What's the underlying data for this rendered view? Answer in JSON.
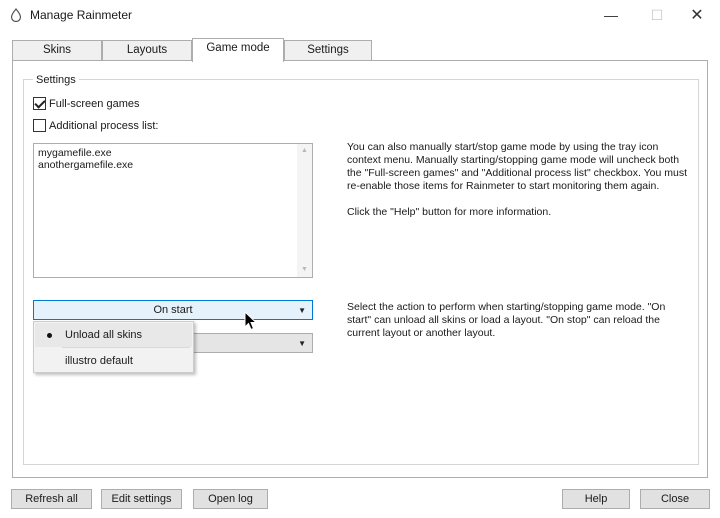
{
  "window": {
    "title": "Manage Rainmeter",
    "app_icon": "rainmeter-drop-icon",
    "controls": {
      "minimize": "—",
      "maximize": "☐",
      "close": "✕"
    }
  },
  "tabs": [
    {
      "label": "Skins",
      "active": false
    },
    {
      "label": "Layouts",
      "active": false
    },
    {
      "label": "Game mode",
      "active": true
    },
    {
      "label": "Settings",
      "active": false
    }
  ],
  "settings": {
    "group_label": "Settings",
    "fullscreen_label": "Full-screen games",
    "fullscreen_checked": true,
    "process_list_label": "Additional process list:",
    "process_list_checked": false,
    "process_items": [
      "mygamefile.exe",
      "anothergamefile.exe"
    ],
    "description_1": "You can also manually start/stop game mode by using the tray icon context menu. Manually starting/stopping game mode will uncheck both the \"Full-screen games\" and \"Additional process list\" checkbox. You must re-enable those items for Rainmeter to start monitoring them again.",
    "description_2": "Click the \"Help\" button for more information.",
    "description_3": "Select the action to perform when starting/stopping game mode. \"On start\" can unload all skins or load a layout. \"On stop\" can reload the current layout or another layout.",
    "on_start_value": "On start",
    "on_stop_value": "",
    "dropdown_options": [
      {
        "label": "Unload all skins",
        "selected": true
      },
      {
        "label": "illustro default",
        "selected": false
      }
    ]
  },
  "buttons": {
    "refresh_all": "Refresh all",
    "edit_settings": "Edit settings",
    "open_log": "Open log",
    "help": "Help",
    "close": "Close"
  },
  "colors": {
    "focus_border": "#0078d7",
    "focus_fill": "#e5f1fb",
    "button_face": "#e1e1e1"
  }
}
